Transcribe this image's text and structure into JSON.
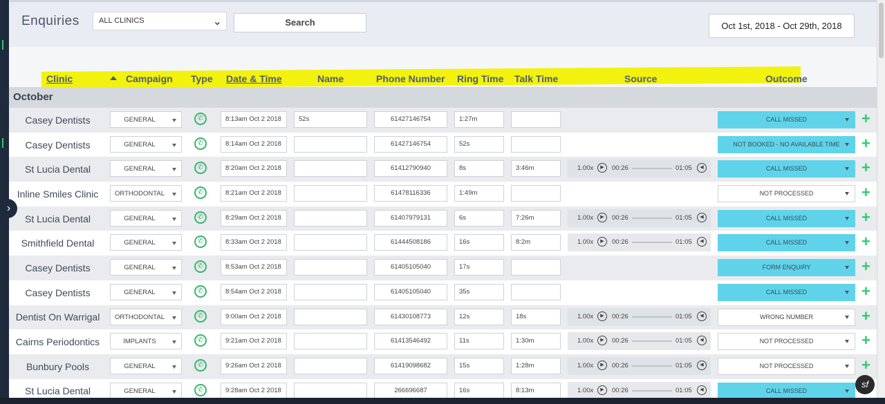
{
  "header": {
    "title": "Enquiries",
    "clinic_filter": "ALL CLINICS",
    "search_label": "Search",
    "date_range": "Oct 1st, 2018 - Oct 29th, 2018"
  },
  "columns": [
    "Clinic",
    "Campaign",
    "Type",
    "Date & Time",
    "Name",
    "Phone Number",
    "Ring Time",
    "Talk Time",
    "Source",
    "Outcome"
  ],
  "month": "October",
  "rows": [
    {
      "clinic": "Casey Dentists",
      "campaign": "GENERAL",
      "datetime": "8:13am Oct 2 2018",
      "name": "52s",
      "phone": "61427146754",
      "ring": "1:27m",
      "talk": "",
      "has_player": false,
      "outcome": "CALL MISSED",
      "outcome_style": "cyan"
    },
    {
      "clinic": "Casey Dentists",
      "campaign": "GENERAL",
      "datetime": "8:14am Oct 2 2018",
      "name": "",
      "phone": "61427146754",
      "ring": "52s",
      "talk": "",
      "has_player": false,
      "outcome": "NOT BOOKED - NO AVAILABLE TIME",
      "outcome_style": "cyan"
    },
    {
      "clinic": "St Lucia Dental",
      "campaign": "GENERAL",
      "datetime": "8:20am Oct 2 2018",
      "name": "",
      "phone": "61412790940",
      "ring": "8s",
      "talk": "3:46m",
      "has_player": true,
      "player_speed": "1.00x",
      "player_current": "00:26",
      "player_duration": "01:05",
      "outcome": "CALL MISSED",
      "outcome_style": "cyan"
    },
    {
      "clinic": "Inline Smiles Clinic",
      "campaign": "ORTHODONTAL",
      "datetime": "8:21am Oct 2 2018",
      "name": "",
      "phone": "61478116336",
      "ring": "1:49m",
      "talk": "",
      "has_player": false,
      "outcome": "NOT PROCESSED",
      "outcome_style": "white"
    },
    {
      "clinic": "St Lucia Dental",
      "campaign": "GENERAL",
      "datetime": "8:29am Oct 2 2018",
      "name": "",
      "phone": "61407979131",
      "ring": "6s",
      "talk": "7:26m",
      "has_player": true,
      "player_speed": "1.00x",
      "player_current": "00:26",
      "player_duration": "01:05",
      "outcome": "CALL MISSED",
      "outcome_style": "cyan"
    },
    {
      "clinic": "Smithfield Dental",
      "campaign": "GENERAL",
      "datetime": "8:33am Oct 2 2018",
      "name": "",
      "phone": "61444508186",
      "ring": "16s",
      "talk": "8:2m",
      "has_player": true,
      "player_speed": "1.00x",
      "player_current": "00:26",
      "player_duration": "01:05",
      "outcome": "CALL MISSED",
      "outcome_style": "cyan"
    },
    {
      "clinic": "Casey Dentists",
      "campaign": "GENERAL",
      "datetime": "8:53am Oct 2 2018",
      "name": "",
      "phone": "61405105040",
      "ring": "17s",
      "talk": "",
      "has_player": false,
      "outcome": "FORM ENQUIRY",
      "outcome_style": "cyan"
    },
    {
      "clinic": "Casey Dentists",
      "campaign": "GENERAL",
      "datetime": "8:54am Oct 2 2018",
      "name": "",
      "phone": "61405105040",
      "ring": "35s",
      "talk": "",
      "has_player": false,
      "outcome": "CALL MISSED",
      "outcome_style": "cyan"
    },
    {
      "clinic": "Dentist On Warrigal",
      "campaign": "ORTHODONTAL",
      "datetime": "9:00am Oct 2 2018",
      "name": "",
      "phone": "61430108773",
      "ring": "12s",
      "talk": "18s",
      "has_player": true,
      "player_speed": "1.00x",
      "player_current": "00:26",
      "player_duration": "01:05",
      "outcome": "WRONG NUMBER",
      "outcome_style": "white"
    },
    {
      "clinic": "Cairns Periodontics",
      "campaign": "IMPLANTS",
      "datetime": "9:21am Oct 2 2018",
      "name": "",
      "phone": "61413546492",
      "ring": "11s",
      "talk": "1:30m",
      "has_player": true,
      "player_speed": "1.00x",
      "player_current": "00:26",
      "player_duration": "01:05",
      "outcome": "NOT PROCESSED",
      "outcome_style": "white"
    },
    {
      "clinic": "Bunbury Pools",
      "campaign": "GENERAL",
      "datetime": "9:26am Oct 2 2018",
      "name": "",
      "phone": "61419098682",
      "ring": "15s",
      "talk": "1:28m",
      "has_player": true,
      "player_speed": "1.00x",
      "player_current": "00:26",
      "player_duration": "01:05",
      "outcome": "NOT PROCESSED",
      "outcome_style": "white"
    },
    {
      "clinic": "St Lucia Dental",
      "campaign": "GENERAL",
      "datetime": "9:28am Oct 2 2018",
      "name": "",
      "phone": "266696687",
      "ring": "16s",
      "talk": "8:13m",
      "has_player": true,
      "player_speed": "1.00x",
      "player_current": "00:26",
      "player_duration": "01:05",
      "outcome": "CALL MISSED",
      "outcome_style": "cyan"
    }
  ],
  "icons": {
    "type": "phone-icon",
    "add": "plus-icon",
    "collapse": "chevron-right-icon",
    "badge": "symfony-icon"
  },
  "colors": {
    "highlight": "#f2f20e",
    "outcome_cyan": "#5fd3ea",
    "accent_green": "#2ecc71",
    "sidebar": "#1f2a3c"
  }
}
